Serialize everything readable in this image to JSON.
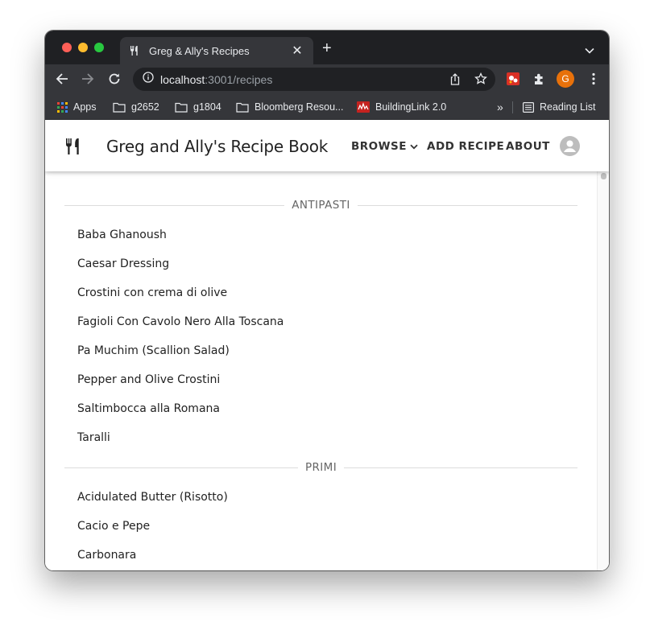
{
  "browser": {
    "tab_title": "Greg & Ally's Recipes",
    "url_host": "localhost",
    "url_path": ":3001/recipes",
    "profile_initial": "G",
    "bookmarks": [
      {
        "label": "Apps"
      },
      {
        "label": "g2652"
      },
      {
        "label": "g1804"
      },
      {
        "label": "Bloomberg Resou..."
      },
      {
        "label": "BuildingLink 2.0"
      }
    ],
    "overflow_label": "»",
    "reading_list": "Reading List"
  },
  "app": {
    "title": "Greg and Ally's Recipe Book",
    "nav": {
      "browse": "BROWSE",
      "add_recipe": "ADD RECIPE",
      "about": "ABOUT"
    }
  },
  "sections": [
    {
      "name": "ANTIPASTI",
      "recipes": [
        "Baba Ghanoush",
        "Caesar Dressing",
        "Crostini con crema di olive",
        "Fagioli Con Cavolo Nero Alla Toscana",
        "Pa Muchim (Scallion Salad)",
        "Pepper and Olive Crostini",
        "Saltimbocca alla Romana",
        "Taralli"
      ]
    },
    {
      "name": "PRIMI",
      "recipes": [
        "Acidulated Butter (Risotto)",
        "Cacio e Pepe",
        "Carbonara"
      ]
    }
  ],
  "colors": {
    "accent_profile": "#e8710a",
    "chrome_dark": "#1f2023",
    "chrome_toolbar": "#35363a"
  }
}
